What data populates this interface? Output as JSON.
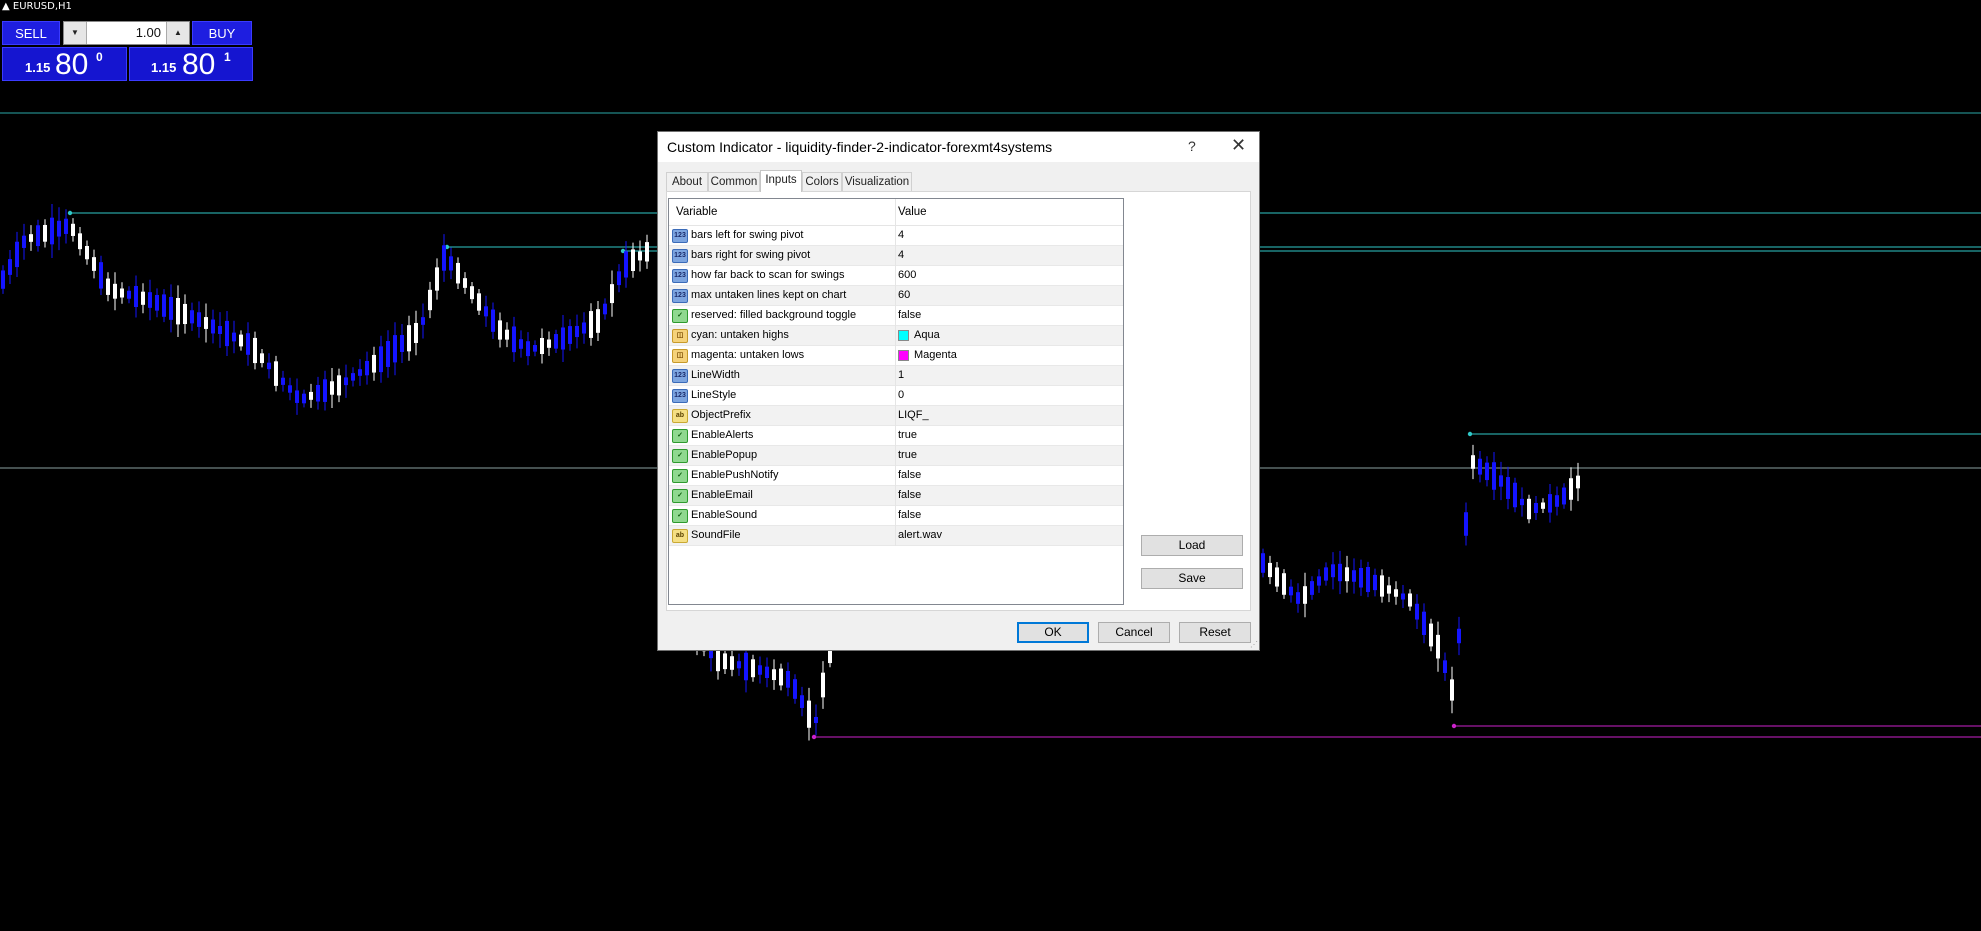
{
  "chart": {
    "symbol": "EURUSD,H1",
    "colors": {
      "background": "#000000",
      "bull_candle": "#ffffff",
      "bear_candle": "#1414ff",
      "high_line": "#2fc7c7",
      "low_line": "#cc22cc",
      "horizontal_line": "#2aa8a8"
    }
  },
  "trade_panel": {
    "sell_label": "SELL",
    "buy_label": "BUY",
    "lot_size": "1.00",
    "lot_down_icon": "triangle-down",
    "lot_up_icon": "triangle-up",
    "bid": {
      "small": "1.15",
      "big": "80",
      "sup": "0"
    },
    "ask": {
      "small": "1.15",
      "big": "80",
      "sup": "1"
    }
  },
  "dialog": {
    "title": "Custom Indicator - liquidity-finder-2-indicator-forexmt4systems",
    "help": "?",
    "close": "✕",
    "tabs": [
      "About",
      "Common",
      "Inputs",
      "Colors",
      "Visualization"
    ],
    "active_tab": "Inputs",
    "columns": {
      "variable": "Variable",
      "value": "Value"
    },
    "rows": [
      {
        "type": "num",
        "icon_text": "123",
        "variable": "bars left for swing pivot",
        "value": "4"
      },
      {
        "type": "num",
        "icon_text": "123",
        "variable": "bars right for swing pivot",
        "value": "4"
      },
      {
        "type": "num",
        "icon_text": "123",
        "variable": "how far back to scan for swings",
        "value": "600"
      },
      {
        "type": "num",
        "icon_text": "123",
        "variable": "max untaken lines kept on chart",
        "value": "60"
      },
      {
        "type": "bool",
        "icon_text": "✓",
        "variable": "reserved: filled background toggle",
        "value": "false"
      },
      {
        "type": "color",
        "icon_text": "◫",
        "variable": "cyan: untaken highs",
        "value": "Aqua",
        "swatch": "#00ffff"
      },
      {
        "type": "color",
        "icon_text": "◫",
        "variable": "magenta: untaken lows",
        "value": "Magenta",
        "swatch": "#ff00ff"
      },
      {
        "type": "num",
        "icon_text": "123",
        "variable": "LineWidth",
        "value": "1"
      },
      {
        "type": "num",
        "icon_text": "123",
        "variable": "LineStyle",
        "value": "0"
      },
      {
        "type": "str",
        "icon_text": "ab",
        "variable": "ObjectPrefix",
        "value": "LIQF_"
      },
      {
        "type": "bool",
        "icon_text": "✓",
        "variable": "EnableAlerts",
        "value": "true"
      },
      {
        "type": "bool",
        "icon_text": "✓",
        "variable": "EnablePopup",
        "value": "true"
      },
      {
        "type": "bool",
        "icon_text": "✓",
        "variable": "EnablePushNotify",
        "value": "false"
      },
      {
        "type": "bool",
        "icon_text": "✓",
        "variable": "EnableEmail",
        "value": "false"
      },
      {
        "type": "bool",
        "icon_text": "✓",
        "variable": "EnableSound",
        "value": "false"
      },
      {
        "type": "str",
        "icon_text": "ab",
        "variable": "SoundFile",
        "value": "alert.wav"
      }
    ],
    "load_label": "Load",
    "save_label": "Save",
    "ok_label": "OK",
    "cancel_label": "Cancel",
    "reset_label": "Reset"
  }
}
